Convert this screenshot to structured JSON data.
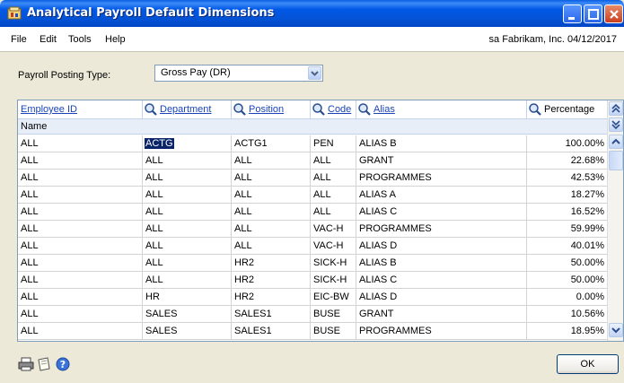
{
  "window": {
    "title": "Analytical Payroll Default Dimensions"
  },
  "menu": {
    "items": [
      "File",
      "Edit",
      "Tools",
      "Help"
    ],
    "user_info": "sa  Fabrikam, Inc. 04/12/2017"
  },
  "posting": {
    "label": "Payroll Posting Type:",
    "value": "Gross Pay (DR)"
  },
  "grid": {
    "headers": {
      "employee_id": "Employee ID",
      "department": "Department",
      "position": "Position",
      "code": "Code",
      "alias": "Alias",
      "percentage": "Percentage"
    },
    "name_label": "Name",
    "rows": [
      [
        "ALL",
        "ACTG",
        "ACTG1",
        "PEN",
        "ALIAS B",
        "100.00%"
      ],
      [
        "ALL",
        "ALL",
        "ALL",
        "ALL",
        "GRANT",
        "22.68%"
      ],
      [
        "ALL",
        "ALL",
        "ALL",
        "ALL",
        "PROGRAMMES",
        "42.53%"
      ],
      [
        "ALL",
        "ALL",
        "ALL",
        "ALL",
        "ALIAS A",
        "18.27%"
      ],
      [
        "ALL",
        "ALL",
        "ALL",
        "ALL",
        "ALIAS C",
        "16.52%"
      ],
      [
        "ALL",
        "ALL",
        "ALL",
        "VAC-H",
        "PROGRAMMES",
        "59.99%"
      ],
      [
        "ALL",
        "ALL",
        "ALL",
        "VAC-H",
        "ALIAS D",
        "40.01%"
      ],
      [
        "ALL",
        "ALL",
        "HR2",
        "SICK-H",
        "ALIAS B",
        "50.00%"
      ],
      [
        "ALL",
        "ALL",
        "HR2",
        "SICK-H",
        "ALIAS C",
        "50.00%"
      ],
      [
        "ALL",
        "HR",
        "HR2",
        "EIC-BW",
        "ALIAS D",
        "0.00%"
      ],
      [
        "ALL",
        "SALES",
        "SALES1",
        "BUSE",
        "GRANT",
        "10.56%"
      ],
      [
        "ALL",
        "SALES",
        "SALES1",
        "BUSE",
        "PROGRAMMES",
        "18.95%"
      ]
    ]
  },
  "buttons": {
    "ok": "OK"
  },
  "icons": [
    "app-icon",
    "lookup-icon",
    "print-icon",
    "note-icon",
    "help-icon"
  ],
  "colors": {
    "titlebar": "#0058e6",
    "link": "#1a44b8",
    "selection": "#0a246a",
    "window_bg": "#ece9d8"
  }
}
